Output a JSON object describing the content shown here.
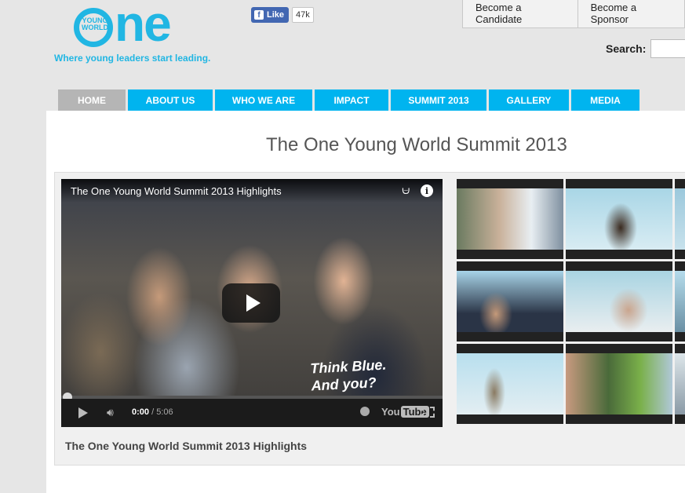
{
  "logo": {
    "young_world": "YOUNG WORLD",
    "ne": "ne",
    "tagline": "Where young leaders start leading."
  },
  "facebook": {
    "like_label": "Like",
    "count": "47k"
  },
  "header": {
    "candidate_label": "Become a Candidate",
    "sponsor_label": "Become a Sponsor",
    "search_label": "Search:",
    "search_value": ""
  },
  "nav": [
    {
      "label": "HOME",
      "active": true
    },
    {
      "label": "ABOUT US"
    },
    {
      "label": "WHO WE ARE"
    },
    {
      "label": "IMPACT"
    },
    {
      "label": "SUMMIT 2013"
    },
    {
      "label": "GALLERY"
    },
    {
      "label": "MEDIA"
    }
  ],
  "page": {
    "title": "The One Young World Summit 2013"
  },
  "video": {
    "title": "The One Young World Summit 2013 Highlights",
    "shirt_text": "Think Blue.\nAnd you?",
    "time_current": "0:00",
    "time_total": "/ 5:06",
    "youtube_label": "You",
    "youtube_tube": "Tube",
    "caption": "The One Young World Summit 2013 Highlights",
    "progress": 0
  },
  "colors": {
    "brand": "#21b6e3",
    "nav": "#00b4ef",
    "nav_active": "#b5b5b5"
  },
  "thumbnails": [
    "crowd-photo",
    "speaker-photo",
    "speaker-photo",
    "speaker-photo",
    "speaker-photo",
    "speaker-photo",
    "speaker-photo",
    "crowd-photo",
    "speaker-photo"
  ]
}
